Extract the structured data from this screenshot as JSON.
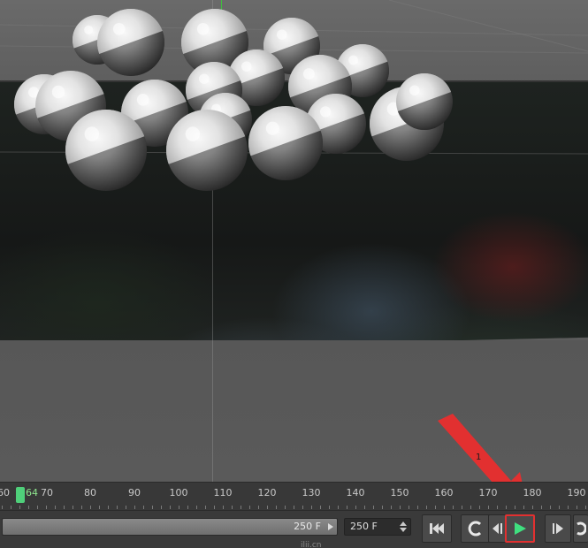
{
  "timeline": {
    "ticks": [
      "60",
      "64",
      "70",
      "80",
      "90",
      "100",
      "110",
      "120",
      "130",
      "140",
      "150",
      "160",
      "170",
      "180",
      "190"
    ],
    "current_frame": "64"
  },
  "bottombar": {
    "range_end_label": "250 F",
    "end_frame_value": "250 F",
    "watermark": "ilii.cn"
  },
  "annotation": {
    "number": "1",
    "arrow_color": "#e23030"
  },
  "colors": {
    "playhead": "#4fd07a",
    "play_icon": "#3fe07f",
    "highlight": "#e23030"
  },
  "icons": {
    "go_to_start": "go-to-start-icon",
    "loop": "loop-icon",
    "prev_key": "previous-keyframe-icon",
    "play": "play-forward-icon",
    "next_key": "next-keyframe-icon"
  }
}
